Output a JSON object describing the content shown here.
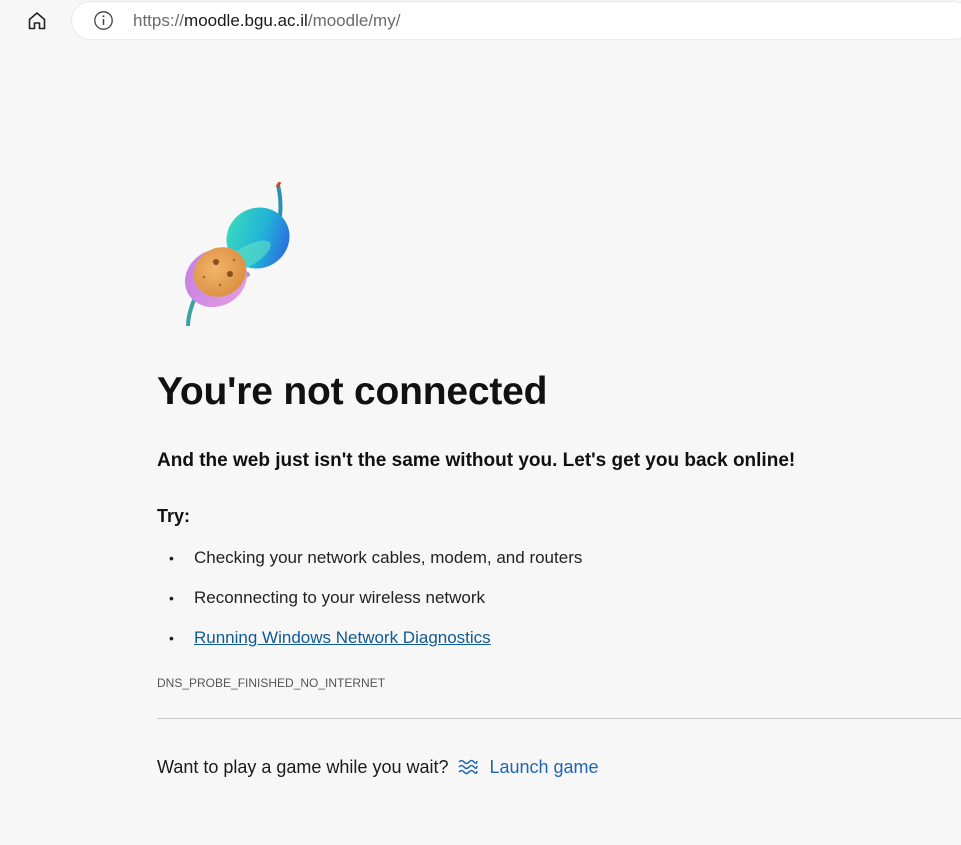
{
  "browser": {
    "url_scheme": "https://",
    "url_host": "moodle.bgu.ac.il",
    "url_path": "/moodle/my/",
    "home_icon": "home-icon",
    "info_icon": "info-icon"
  },
  "error_page": {
    "title": "You're not connected",
    "subtitle": "And the web just isn't the same without you. Let's get you back online!",
    "try_label": "Try:",
    "suggestions": [
      {
        "text": "Checking your network cables, modem, and routers"
      },
      {
        "text": "Reconnecting to your wireless network"
      },
      {
        "text": "Running Windows Network Diagnostics"
      }
    ],
    "bullet": "•",
    "error_code": "DNS_PROBE_FINISHED_NO_INTERNET",
    "game_prompt": "Want to play a game while you wait?",
    "launch_game": "Launch game",
    "illustration_icon": "unplugged-connector-icon",
    "game_icon": "waves-icon"
  },
  "colors": {
    "background": "#f7f7f7",
    "link": "#0f5a97",
    "launch_link": "#2166b4"
  }
}
